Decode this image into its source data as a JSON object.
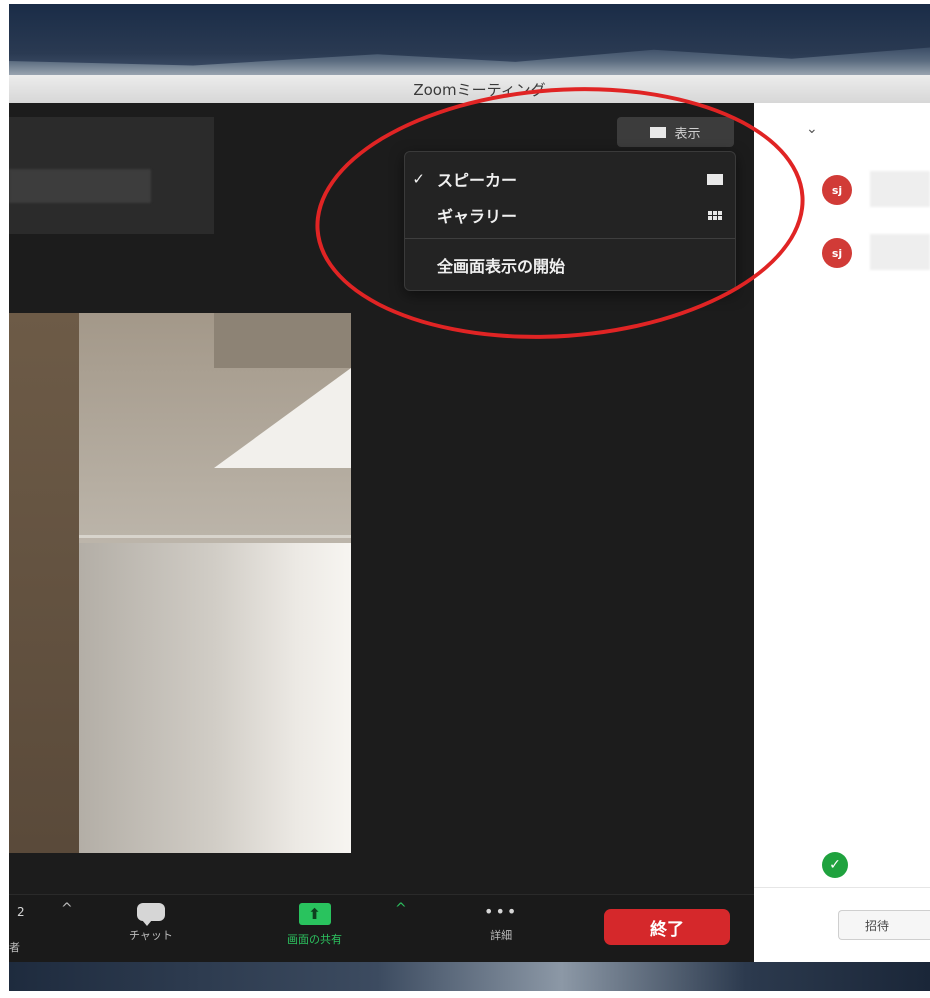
{
  "window": {
    "title": "Zoomミーティング"
  },
  "view_button": {
    "label": "表示"
  },
  "view_menu": {
    "items": [
      {
        "label": "スピーカー",
        "checked": true,
        "check_mark": "✓",
        "icon": "speaker-view-icon"
      },
      {
        "label": "ギャラリー",
        "checked": false,
        "check_mark": "",
        "icon": "gallery-grid-icon"
      },
      {
        "label": "全画面表示の開始",
        "checked": false,
        "check_mark": "",
        "icon": ""
      }
    ]
  },
  "toolbar": {
    "participants_count": "2",
    "participants_partial_label": "者",
    "chat_label": "チャット",
    "share_label": "画面の共有",
    "share_arrow": "⬆",
    "more_label": "詳細",
    "more_glyph": "•••",
    "end_label": "終了",
    "caret": "^"
  },
  "side_panel": {
    "chevron": "⌄",
    "participants": [
      {
        "initials": "sj"
      },
      {
        "initials": "sj"
      }
    ],
    "status_glyph": "✓",
    "invite_label": "招待"
  },
  "colors": {
    "annotation": "#e02424",
    "end_button": "#d5282b",
    "share_green": "#29c35e",
    "avatar_red": "#d13b37"
  }
}
